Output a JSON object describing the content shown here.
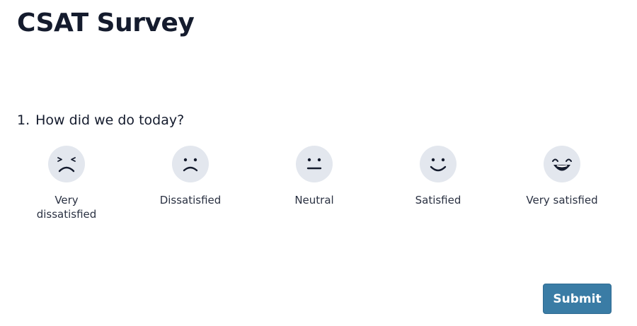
{
  "page": {
    "title": "CSAT Survey"
  },
  "question": {
    "number": "1.",
    "text": "How did we do today?",
    "options": [
      {
        "label": "Very dissatisfied",
        "icon": "very-dissatisfied-face-icon"
      },
      {
        "label": "Dissatisfied",
        "icon": "dissatisfied-face-icon"
      },
      {
        "label": "Neutral",
        "icon": "neutral-face-icon"
      },
      {
        "label": "Satisfied",
        "icon": "satisfied-face-icon"
      },
      {
        "label": "Very satisfied",
        "icon": "very-satisfied-face-icon"
      }
    ]
  },
  "actions": {
    "submit_label": "Submit"
  },
  "colors": {
    "face_background": "#e3e7ee",
    "face_feature": "#141b2d",
    "submit_background": "#3a7ca5",
    "title_text": "#141b2d"
  }
}
